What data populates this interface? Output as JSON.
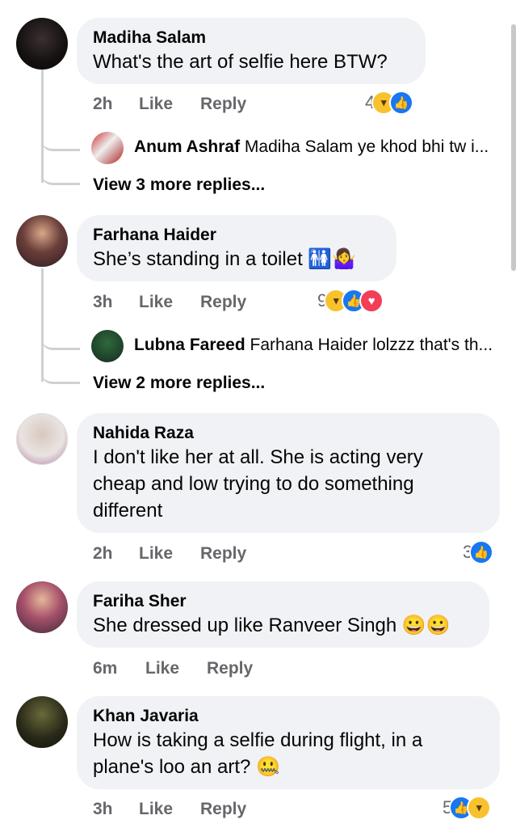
{
  "comments": [
    {
      "author": "Madiha Salam",
      "text": "What's the art of selfie here BTW?",
      "time": "2h",
      "like_label": "Like",
      "reply_label": "Reply",
      "reaction_count": "4",
      "reactions": [
        "haha-icon",
        "like-icon"
      ],
      "reply_preview": {
        "author": "Anum Ashraf",
        "text": "Madiha Salam ye khod bhi tw i..."
      },
      "more_replies": "View 3 more replies..."
    },
    {
      "author": "Farhana Haider",
      "text": "She’s standing in a toilet 🚻🤷‍♀️",
      "time": "3h",
      "like_label": "Like",
      "reply_label": "Reply",
      "reaction_count": "9",
      "reactions": [
        "haha-icon",
        "like-icon",
        "love-icon"
      ],
      "reply_preview": {
        "author": "Lubna Fareed",
        "text": "Farhana Haider lolzzz that's th..."
      },
      "more_replies": "View 2 more replies..."
    },
    {
      "author": "Nahida Raza",
      "text_lines": [
        "I don't like her at all. She is acting very",
        "cheap and low trying to do something",
        "different"
      ],
      "time": "2h",
      "like_label": "Like",
      "reply_label": "Reply",
      "reaction_count": "3",
      "reactions": [
        "like-icon"
      ]
    },
    {
      "author": "Fariha Sher",
      "text": "She dressed up like Ranveer Singh 😀😀",
      "time": "6m",
      "like_label": "Like",
      "reply_label": "Reply"
    },
    {
      "author": "Khan Javaria",
      "text_lines": [
        "How is taking a selfie during flight, in a",
        "plane's loo an art? 🤐"
      ],
      "time": "3h",
      "like_label": "Like",
      "reply_label": "Reply",
      "reaction_count": "5",
      "reactions": [
        "like-icon",
        "haha-icon"
      ]
    }
  ],
  "colors": {
    "bubble": "#f0f2f5",
    "meta": "#65676b",
    "like": "#1877f2",
    "haha": "#f7c22e",
    "love": "#f33e58"
  }
}
